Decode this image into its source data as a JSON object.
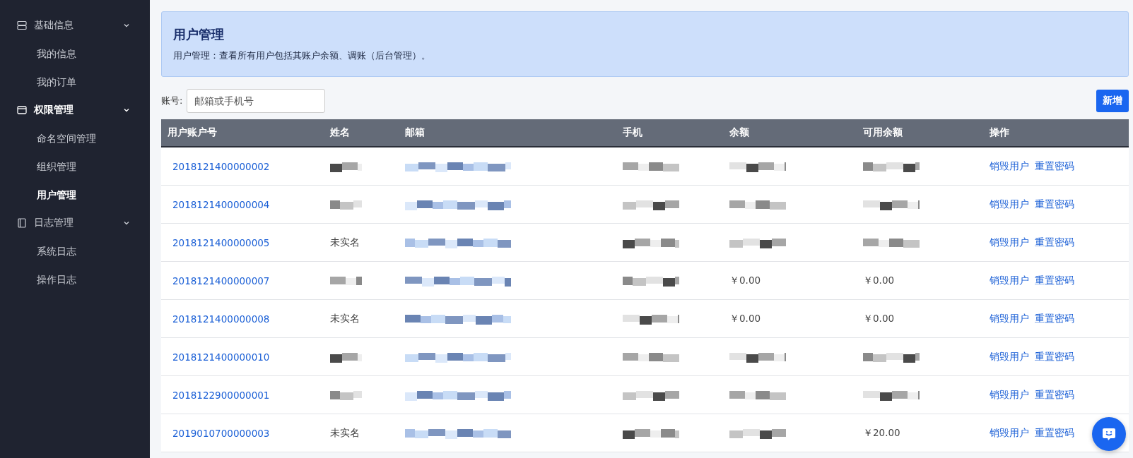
{
  "sidebar": {
    "groups": [
      {
        "label": "基础信息",
        "kind": "server",
        "active": false,
        "expanded": true,
        "items": [
          {
            "label": "我的信息",
            "selected": false
          },
          {
            "label": "我的订单",
            "selected": false
          }
        ]
      },
      {
        "label": "权限管理",
        "kind": "window",
        "active": true,
        "expanded": true,
        "items": [
          {
            "label": "命名空间管理",
            "selected": false
          },
          {
            "label": "组织管理",
            "selected": false
          },
          {
            "label": "用户管理",
            "selected": true
          }
        ]
      },
      {
        "label": "日志管理",
        "kind": "book",
        "active": false,
        "expanded": true,
        "items": [
          {
            "label": "系统日志",
            "selected": false
          },
          {
            "label": "操作日志",
            "selected": false
          }
        ]
      }
    ]
  },
  "header": {
    "title": "用户管理",
    "description": "用户管理：查看所有用户包括其账户余额、调账（后台管理）。"
  },
  "search": {
    "label": "账号:",
    "placeholder": "邮箱或手机号"
  },
  "add_button": "新增",
  "table": {
    "columns": [
      "用户账户号",
      "姓名",
      "邮箱",
      "手机",
      "余额",
      "可用余额",
      "操作"
    ],
    "rows": [
      {
        "cells": [
          {
            "kind": "link",
            "text": "2018121400000002"
          },
          {
            "kind": "blurred"
          },
          {
            "kind": "blurred"
          },
          {
            "kind": "blurred"
          },
          {
            "kind": "blurred"
          },
          {
            "kind": "blurred"
          },
          {
            "kind": "actions",
            "links": [
              "销毁用户",
              "重置密码"
            ]
          }
        ]
      },
      {
        "cells": [
          {
            "kind": "link",
            "text": "2018121400000004"
          },
          {
            "kind": "blurred"
          },
          {
            "kind": "blurred"
          },
          {
            "kind": "blurred"
          },
          {
            "kind": "blurred"
          },
          {
            "kind": "blurred"
          },
          {
            "kind": "actions",
            "links": [
              "销毁用户",
              "重置密码"
            ]
          }
        ]
      },
      {
        "cells": [
          {
            "kind": "link",
            "text": "2018121400000005"
          },
          {
            "kind": "text",
            "text": "未实名"
          },
          {
            "kind": "blurred"
          },
          {
            "kind": "blurred"
          },
          {
            "kind": "blurred"
          },
          {
            "kind": "blurred"
          },
          {
            "kind": "actions",
            "links": [
              "销毁用户",
              "重置密码"
            ]
          }
        ]
      },
      {
        "cells": [
          {
            "kind": "link",
            "text": "2018121400000007"
          },
          {
            "kind": "blurred"
          },
          {
            "kind": "blurred"
          },
          {
            "kind": "blurred"
          },
          {
            "kind": "text",
            "text": "￥0.00"
          },
          {
            "kind": "text",
            "text": "￥0.00"
          },
          {
            "kind": "actions",
            "links": [
              "销毁用户",
              "重置密码"
            ]
          }
        ]
      },
      {
        "cells": [
          {
            "kind": "link",
            "text": "2018121400000008"
          },
          {
            "kind": "text",
            "text": "未实名"
          },
          {
            "kind": "blurred"
          },
          {
            "kind": "blurred"
          },
          {
            "kind": "text",
            "text": "￥0.00"
          },
          {
            "kind": "text",
            "text": "￥0.00"
          },
          {
            "kind": "actions",
            "links": [
              "销毁用户",
              "重置密码"
            ]
          }
        ]
      },
      {
        "cells": [
          {
            "kind": "link",
            "text": "2018121400000010"
          },
          {
            "kind": "blurred"
          },
          {
            "kind": "blurred"
          },
          {
            "kind": "blurred"
          },
          {
            "kind": "blurred"
          },
          {
            "kind": "blurred"
          },
          {
            "kind": "actions",
            "links": [
              "销毁用户",
              "重置密码"
            ]
          }
        ]
      },
      {
        "cells": [
          {
            "kind": "link",
            "text": "2018122900000001"
          },
          {
            "kind": "blurred"
          },
          {
            "kind": "blurred"
          },
          {
            "kind": "blurred"
          },
          {
            "kind": "blurred"
          },
          {
            "kind": "blurred"
          },
          {
            "kind": "actions",
            "links": [
              "销毁用户",
              "重置密码"
            ]
          }
        ]
      },
      {
        "cells": [
          {
            "kind": "link",
            "text": "2019010700000003"
          },
          {
            "kind": "text",
            "text": "未实名"
          },
          {
            "kind": "blurred"
          },
          {
            "kind": "blurred"
          },
          {
            "kind": "blurred"
          },
          {
            "kind": "text",
            "text": "￥20.00"
          },
          {
            "kind": "actions",
            "links": [
              "销毁用户",
              "重置密码"
            ]
          }
        ]
      }
    ]
  }
}
